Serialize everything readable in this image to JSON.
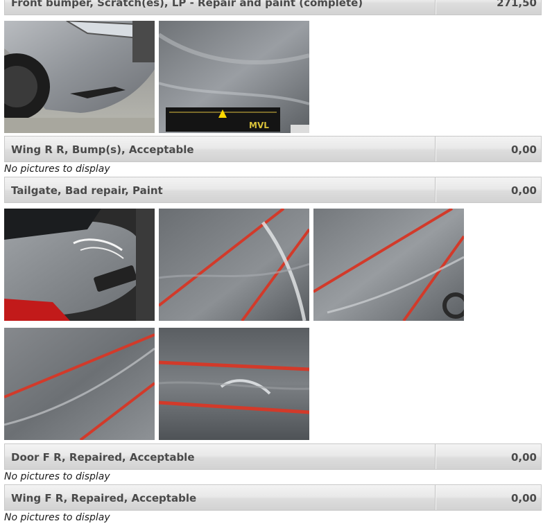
{
  "items": [
    {
      "label": "Front bumper, Scratch(es), LP - Repair and paint (complete)",
      "amount": "271,50"
    },
    {
      "label": "Wing R R, Bump(s), Acceptable",
      "amount": "0,00",
      "note": "No pictures to display"
    },
    {
      "label": "Tailgate, Bad repair, Paint",
      "amount": "0,00"
    },
    {
      "label": "Door F R, Repaired, Acceptable",
      "amount": "0,00",
      "note": "No pictures to display"
    },
    {
      "label": "Wing F R, Repaired, Acceptable",
      "amount": "0,00",
      "note": "No pictures to display"
    }
  ],
  "photos": {
    "bumper_1": "front-bumper-photo",
    "bumper_2": "bumper-gauge-photo",
    "tailgate_1": "tailgate-overview-photo",
    "tailgate_2": "tailgate-closeup-photo",
    "tailgate_3": "tailgate-closeup-photo",
    "tailgate_4": "tailgate-closeup-photo",
    "tailgate_5": "tailgate-closeup-photo"
  },
  "gauge_brand": "MVL"
}
